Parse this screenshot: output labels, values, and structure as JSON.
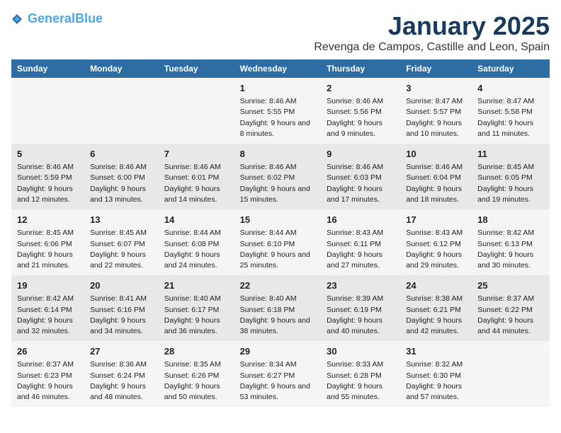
{
  "header": {
    "logo_line1a": "General",
    "logo_line1b": "Blue",
    "month": "January 2025",
    "location": "Revenga de Campos, Castille and Leon, Spain"
  },
  "columns": [
    "Sunday",
    "Monday",
    "Tuesday",
    "Wednesday",
    "Thursday",
    "Friday",
    "Saturday"
  ],
  "weeks": [
    [
      {
        "day": "",
        "text": ""
      },
      {
        "day": "",
        "text": ""
      },
      {
        "day": "",
        "text": ""
      },
      {
        "day": "1",
        "text": "Sunrise: 8:46 AM\nSunset: 5:55 PM\nDaylight: 9 hours and 8 minutes."
      },
      {
        "day": "2",
        "text": "Sunrise: 8:46 AM\nSunset: 5:56 PM\nDaylight: 9 hours and 9 minutes."
      },
      {
        "day": "3",
        "text": "Sunrise: 8:47 AM\nSunset: 5:57 PM\nDaylight: 9 hours and 10 minutes."
      },
      {
        "day": "4",
        "text": "Sunrise: 8:47 AM\nSunset: 5:58 PM\nDaylight: 9 hours and 11 minutes."
      }
    ],
    [
      {
        "day": "5",
        "text": "Sunrise: 8:46 AM\nSunset: 5:59 PM\nDaylight: 9 hours and 12 minutes."
      },
      {
        "day": "6",
        "text": "Sunrise: 8:46 AM\nSunset: 6:00 PM\nDaylight: 9 hours and 13 minutes."
      },
      {
        "day": "7",
        "text": "Sunrise: 8:46 AM\nSunset: 6:01 PM\nDaylight: 9 hours and 14 minutes."
      },
      {
        "day": "8",
        "text": "Sunrise: 8:46 AM\nSunset: 6:02 PM\nDaylight: 9 hours and 15 minutes."
      },
      {
        "day": "9",
        "text": "Sunrise: 8:46 AM\nSunset: 6:03 PM\nDaylight: 9 hours and 17 minutes."
      },
      {
        "day": "10",
        "text": "Sunrise: 8:46 AM\nSunset: 6:04 PM\nDaylight: 9 hours and 18 minutes."
      },
      {
        "day": "11",
        "text": "Sunrise: 8:45 AM\nSunset: 6:05 PM\nDaylight: 9 hours and 19 minutes."
      }
    ],
    [
      {
        "day": "12",
        "text": "Sunrise: 8:45 AM\nSunset: 6:06 PM\nDaylight: 9 hours and 21 minutes."
      },
      {
        "day": "13",
        "text": "Sunrise: 8:45 AM\nSunset: 6:07 PM\nDaylight: 9 hours and 22 minutes."
      },
      {
        "day": "14",
        "text": "Sunrise: 8:44 AM\nSunset: 6:08 PM\nDaylight: 9 hours and 24 minutes."
      },
      {
        "day": "15",
        "text": "Sunrise: 8:44 AM\nSunset: 6:10 PM\nDaylight: 9 hours and 25 minutes."
      },
      {
        "day": "16",
        "text": "Sunrise: 8:43 AM\nSunset: 6:11 PM\nDaylight: 9 hours and 27 minutes."
      },
      {
        "day": "17",
        "text": "Sunrise: 8:43 AM\nSunset: 6:12 PM\nDaylight: 9 hours and 29 minutes."
      },
      {
        "day": "18",
        "text": "Sunrise: 8:42 AM\nSunset: 6:13 PM\nDaylight: 9 hours and 30 minutes."
      }
    ],
    [
      {
        "day": "19",
        "text": "Sunrise: 8:42 AM\nSunset: 6:14 PM\nDaylight: 9 hours and 32 minutes."
      },
      {
        "day": "20",
        "text": "Sunrise: 8:41 AM\nSunset: 6:16 PM\nDaylight: 9 hours and 34 minutes."
      },
      {
        "day": "21",
        "text": "Sunrise: 8:40 AM\nSunset: 6:17 PM\nDaylight: 9 hours and 36 minutes."
      },
      {
        "day": "22",
        "text": "Sunrise: 8:40 AM\nSunset: 6:18 PM\nDaylight: 9 hours and 38 minutes."
      },
      {
        "day": "23",
        "text": "Sunrise: 8:39 AM\nSunset: 6:19 PM\nDaylight: 9 hours and 40 minutes."
      },
      {
        "day": "24",
        "text": "Sunrise: 8:38 AM\nSunset: 6:21 PM\nDaylight: 9 hours and 42 minutes."
      },
      {
        "day": "25",
        "text": "Sunrise: 8:37 AM\nSunset: 6:22 PM\nDaylight: 9 hours and 44 minutes."
      }
    ],
    [
      {
        "day": "26",
        "text": "Sunrise: 8:37 AM\nSunset: 6:23 PM\nDaylight: 9 hours and 46 minutes."
      },
      {
        "day": "27",
        "text": "Sunrise: 8:36 AM\nSunset: 6:24 PM\nDaylight: 9 hours and 48 minutes."
      },
      {
        "day": "28",
        "text": "Sunrise: 8:35 AM\nSunset: 6:26 PM\nDaylight: 9 hours and 50 minutes."
      },
      {
        "day": "29",
        "text": "Sunrise: 8:34 AM\nSunset: 6:27 PM\nDaylight: 9 hours and 53 minutes."
      },
      {
        "day": "30",
        "text": "Sunrise: 8:33 AM\nSunset: 6:28 PM\nDaylight: 9 hours and 55 minutes."
      },
      {
        "day": "31",
        "text": "Sunrise: 8:32 AM\nSunset: 6:30 PM\nDaylight: 9 hours and 57 minutes."
      },
      {
        "day": "",
        "text": ""
      }
    ]
  ]
}
